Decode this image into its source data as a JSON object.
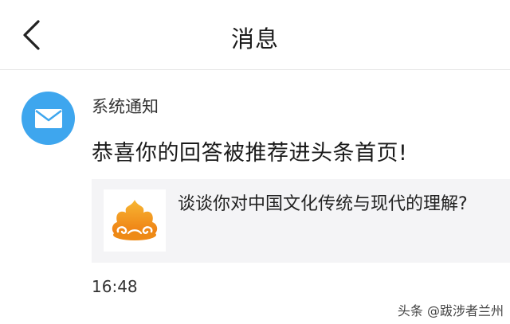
{
  "header": {
    "title": "消息"
  },
  "message": {
    "sender": "系统通知",
    "text": "恭喜你的回答被推荐进头条首页!",
    "card": {
      "title": "谈谈你对中国文化传统与现代的理解?"
    },
    "time": "16:48"
  },
  "watermark": "头条 @跋涉者兰州",
  "icons": {
    "back": "chevron-left-icon",
    "avatar": "mail-icon",
    "card_thumbnail": "flame-logo-icon"
  },
  "colors": {
    "avatar_bg": "#3ea6ee",
    "card_bg": "#f4f4f6",
    "logo_orange": "#f29a1c"
  }
}
